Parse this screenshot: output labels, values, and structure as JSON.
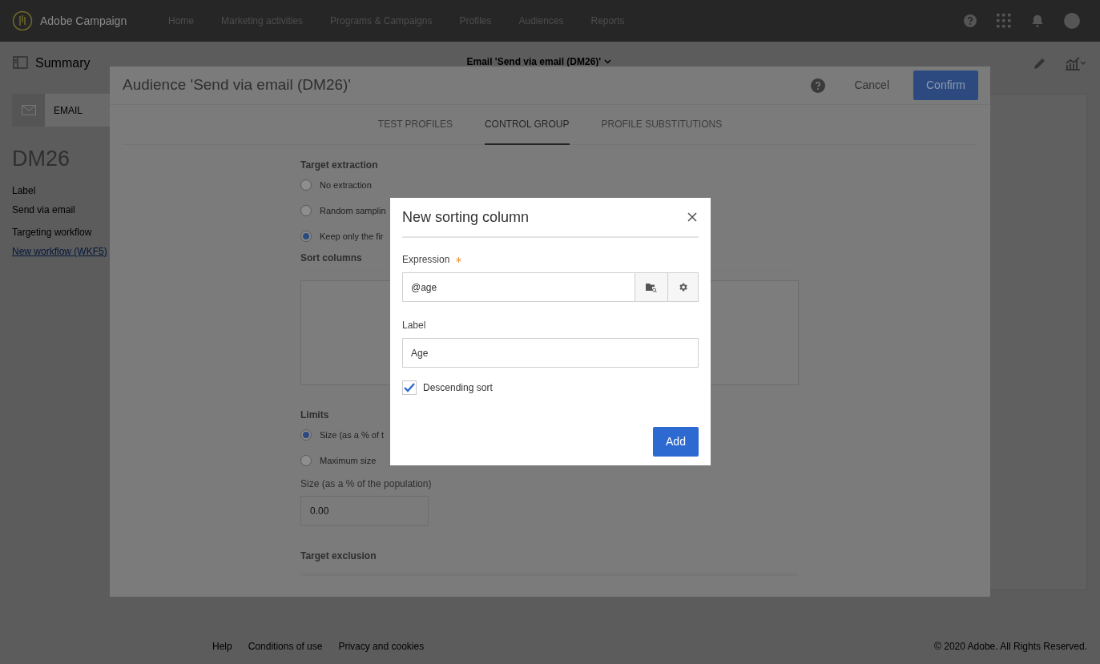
{
  "nav": {
    "brand": "Adobe Campaign",
    "items": [
      {
        "label": "Home"
      },
      {
        "label": "Marketing activities"
      },
      {
        "label": "Programs & Campaigns"
      },
      {
        "label": "Profiles"
      },
      {
        "label": "Audiences"
      },
      {
        "label": "Reports"
      }
    ]
  },
  "page": {
    "title": "Summary",
    "breadcrumb": "Email 'Send via email (DM26)'",
    "channel": "EMAIL",
    "code": "DM26",
    "fields": [
      {
        "label": "Label",
        "value": "Send via email",
        "kind": "text"
      },
      {
        "label": "Targeting workflow",
        "value": "New workflow (WKF5)",
        "kind": "link"
      }
    ]
  },
  "footer": {
    "links": [
      "Help",
      "Conditions of use",
      "Privacy and cookies"
    ],
    "copyright": "© 2020 Adobe. All Rights Reserved."
  },
  "audience_dialog": {
    "title": "Audience 'Send via email (DM26)'",
    "cancel": "Cancel",
    "confirm": "Confirm",
    "tabs": [
      {
        "label": "TEST PROFILES",
        "selected": false
      },
      {
        "label": "CONTROL GROUP",
        "selected": true
      },
      {
        "label": "PROFILE SUBSTITUTIONS",
        "selected": false
      }
    ],
    "target_extraction": {
      "heading": "Target extraction",
      "options": [
        {
          "label": "No extraction",
          "selected": false
        },
        {
          "label": "Random samplin",
          "selected": false
        },
        {
          "label": "Keep only the fir",
          "selected": true
        }
      ]
    },
    "sort_columns": {
      "heading": "Sort columns"
    },
    "limits": {
      "heading": "Limits",
      "options": [
        {
          "label": "Size (as a % of t",
          "selected": true
        },
        {
          "label": "Maximum size",
          "selected": false
        }
      ]
    },
    "size_field": {
      "label": "Size (as a % of the population)",
      "value": "0.00"
    },
    "target_exclusion": {
      "heading": "Target exclusion"
    }
  },
  "sorting_dialog": {
    "title": "New sorting column",
    "expression": {
      "label": "Expression",
      "required": true,
      "value": "@age"
    },
    "label_field": {
      "label": "Label",
      "value": "Age"
    },
    "descending": {
      "label": "Descending sort",
      "checked": true
    },
    "add": "Add"
  }
}
